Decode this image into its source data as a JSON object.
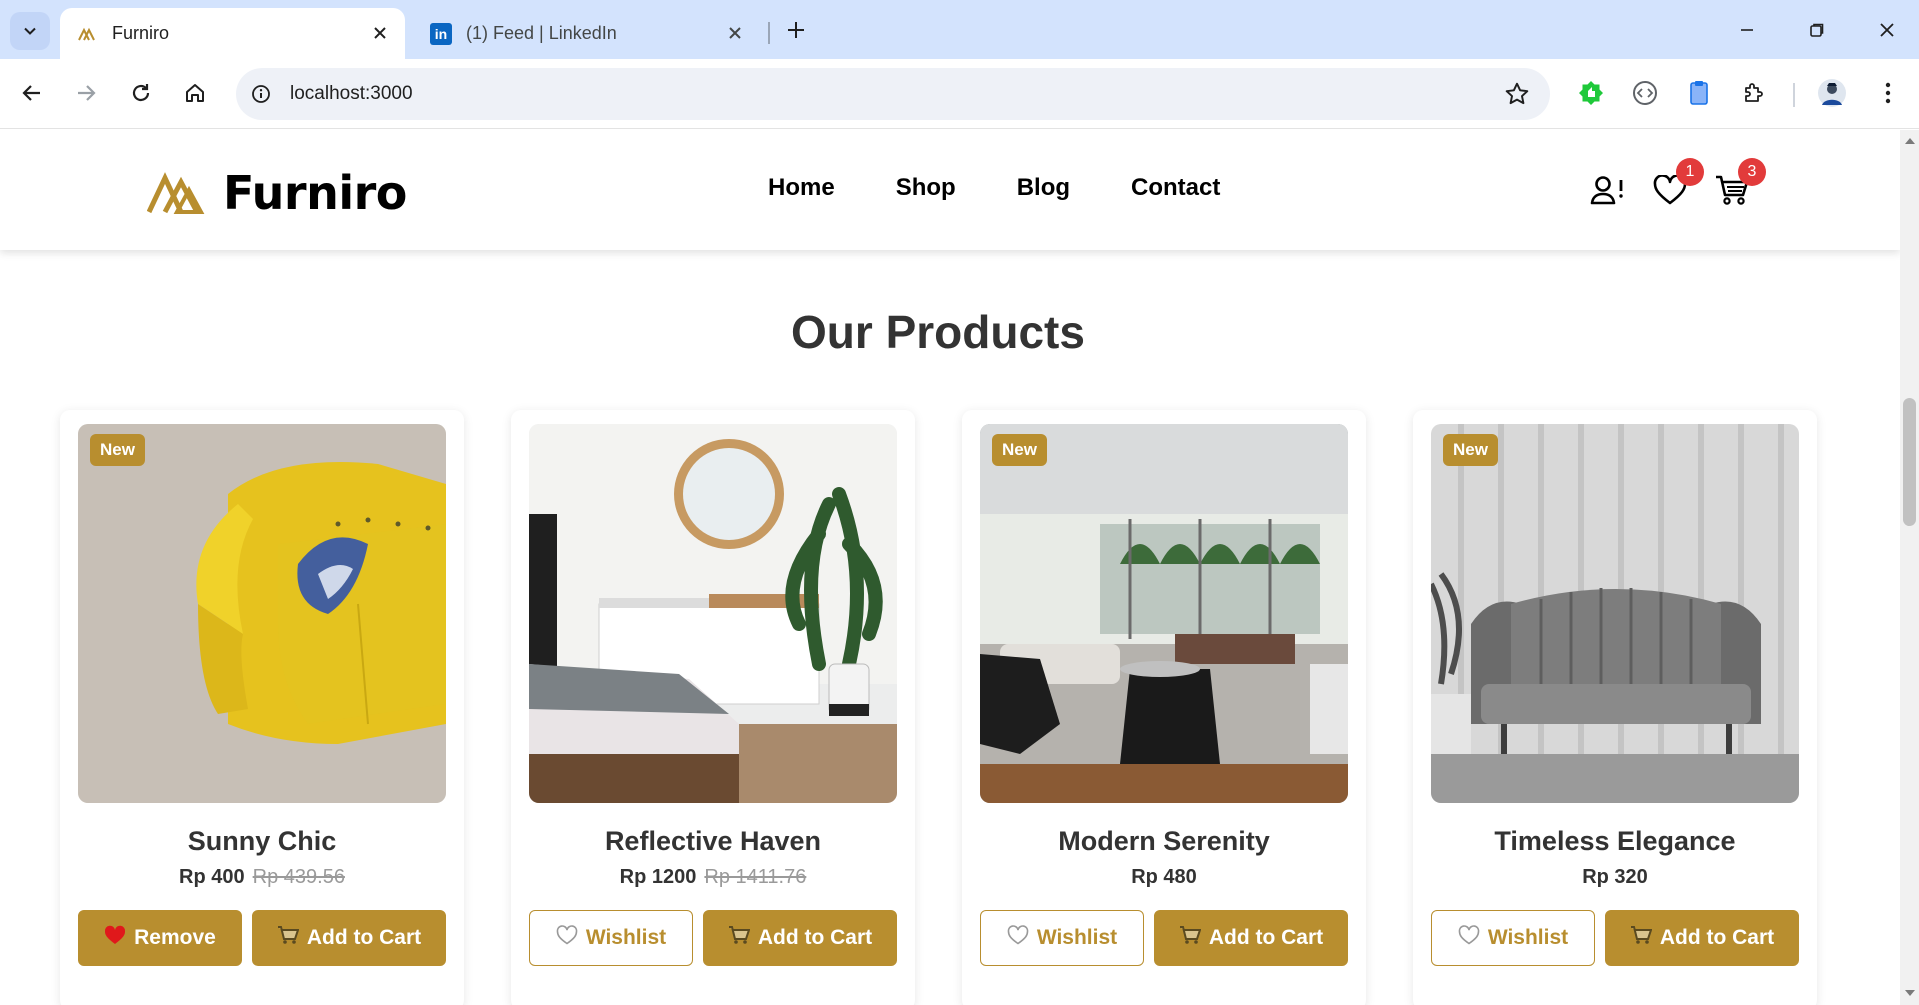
{
  "browser": {
    "tabs": [
      {
        "title": "Furniro",
        "active": true
      },
      {
        "title": "(1) Feed | LinkedIn",
        "active": false
      }
    ],
    "url": "localhost:3000"
  },
  "site": {
    "brand": "Furniro",
    "accent_color": "#b88e2f",
    "nav": [
      "Home",
      "Shop",
      "Blog",
      "Contact"
    ],
    "wishlist_count": "1",
    "cart_count": "3"
  },
  "section": {
    "title": "Our Products"
  },
  "products": [
    {
      "name": "Sunny Chic",
      "price": "Rp 400",
      "old_price": "Rp 439.56",
      "badge": "New",
      "primary_label": "Remove",
      "primary_icon": "heart-filled-icon",
      "cart_label": "Add to Cart"
    },
    {
      "name": "Reflective Haven",
      "price": "Rp 1200",
      "old_price": "Rp 1411.76",
      "badge": "",
      "primary_label": "Wishlist",
      "primary_icon": "heart-outline-icon",
      "cart_label": "Add to Cart"
    },
    {
      "name": "Modern Serenity",
      "price": "Rp 480",
      "old_price": "",
      "badge": "New",
      "primary_label": "Wishlist",
      "primary_icon": "heart-outline-icon",
      "cart_label": "Add to Cart"
    },
    {
      "name": "Timeless Elegance",
      "price": "Rp 320",
      "old_price": "",
      "badge": "New",
      "primary_label": "Wishlist",
      "primary_icon": "heart-outline-icon",
      "cart_label": "Add to Cart"
    }
  ]
}
